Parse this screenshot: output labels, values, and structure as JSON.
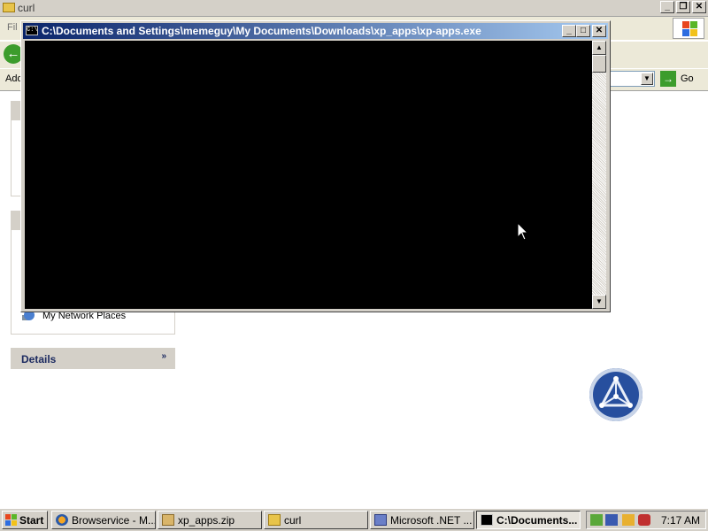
{
  "explorer": {
    "title": "curl",
    "menu_first": "Fil",
    "address_label": "Add",
    "go_label": "Go",
    "places_item": "My Network Places",
    "details_label": "Details",
    "details_chevron": "»"
  },
  "console": {
    "title": "C:\\Documents and Settings\\memeguy\\My Documents\\Downloads\\xp_apps\\xp-apps.exe",
    "icon_text": "C:\\",
    "minimize": "_",
    "maximize": "□",
    "close": "✕"
  },
  "taskbar": {
    "start_label": "Start",
    "buttons": [
      {
        "label": "Browservice - M...",
        "icon": "firefox-icon",
        "active": false
      },
      {
        "label": "xp_apps.zip",
        "icon": "zip-icon",
        "active": false
      },
      {
        "label": "curl",
        "icon": "folder-icon",
        "active": false
      },
      {
        "label": "Microsoft .NET ...",
        "icon": "dotnet-icon",
        "active": false
      },
      {
        "label": "C:\\Documents...",
        "icon": "console-icon",
        "active": true
      }
    ],
    "clock": "7:17 AM"
  },
  "colors": {
    "title_active": "#0a246a",
    "title_gradient_end": "#a6caf0",
    "console_bg": "#000000",
    "chrome": "#d4d0c8"
  }
}
